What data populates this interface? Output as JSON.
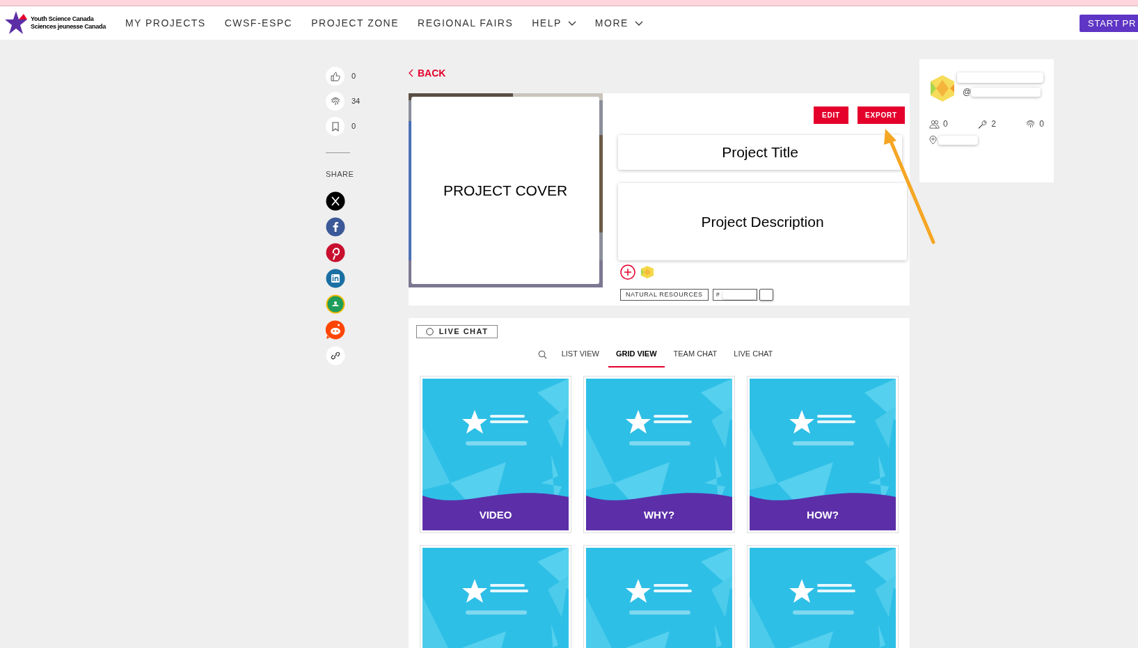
{
  "header": {
    "logo_text": [
      "Youth Science Canada",
      "Sciences jeunesse Canada"
    ],
    "nav": [
      {
        "label": "MY PROJECTS",
        "kind": "link"
      },
      {
        "label": "CWSF-ESPC",
        "kind": "link"
      },
      {
        "label": "PROJECT ZONE",
        "kind": "link"
      },
      {
        "label": "REGIONAL FAIRS",
        "kind": "link"
      },
      {
        "label": "HELP",
        "kind": "dropdown"
      },
      {
        "label": "MORE",
        "kind": "dropdown"
      }
    ],
    "cta": "START PR"
  },
  "sidebar": {
    "stats": [
      {
        "kind": "like",
        "count": "0"
      },
      {
        "kind": "fingerprint",
        "count": "34"
      },
      {
        "kind": "bookmark",
        "count": "0"
      }
    ],
    "share_label": "SHARE",
    "share": [
      {
        "kind": "x"
      },
      {
        "kind": "facebook"
      },
      {
        "kind": "pinterest"
      },
      {
        "kind": "linkedin"
      },
      {
        "kind": "classroom"
      },
      {
        "kind": "reddit"
      },
      {
        "kind": "link"
      }
    ]
  },
  "back": "BACK",
  "project": {
    "cover": "PROJECT COVER",
    "buttons": [
      "EDIT",
      "EXPORT"
    ],
    "title": "Project Title",
    "description": "Project Description",
    "tags": [
      {
        "kind": "topic",
        "label": "NATURAL RESOURCES"
      },
      {
        "kind": "hashtag",
        "label": "#"
      },
      {
        "kind": "blank"
      }
    ]
  },
  "profile": {
    "handle_prefix": "@",
    "stats": [
      {
        "kind": "members",
        "count": "0"
      },
      {
        "kind": "tools",
        "count": "2"
      },
      {
        "kind": "fingerprint",
        "count": "0"
      }
    ]
  },
  "chat": {
    "live_chat_button": "LIVE CHAT",
    "tabs": [
      {
        "label": "LIST VIEW",
        "selected": false
      },
      {
        "label": "GRID VIEW",
        "selected": true
      },
      {
        "label": "TEAM CHAT",
        "selected": false
      },
      {
        "label": "LIVE CHAT",
        "selected": false
      }
    ],
    "tiles": [
      {
        "kind": "picture",
        "label": "VIDEO"
      },
      {
        "kind": "picture",
        "label": "WHY?"
      },
      {
        "kind": "picture",
        "label": "HOW?"
      },
      {
        "kind": "picture"
      },
      {
        "kind": "picture"
      },
      {
        "kind": "picture"
      }
    ]
  }
}
